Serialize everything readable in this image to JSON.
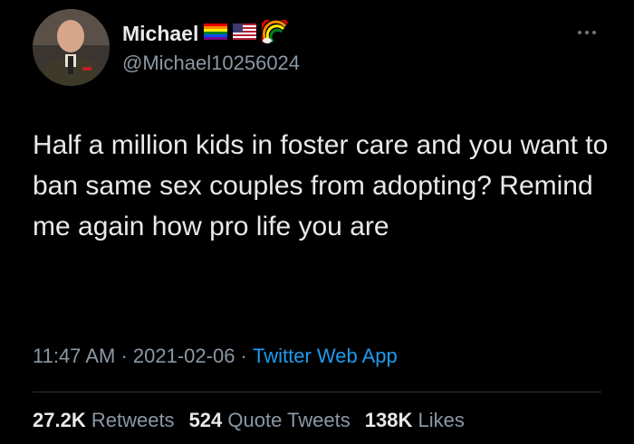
{
  "author": {
    "display_name": "Michael",
    "handle": "@Michael10256024",
    "name_emojis": [
      "rainbow-flag-icon",
      "us-flag-icon",
      "rainbow-icon"
    ]
  },
  "tweet": {
    "text": "Half a million kids in foster care and you want to ban same sex couples from adopting? Remind me again how pro life you are"
  },
  "meta": {
    "time": "11:47 AM",
    "sep1": " · ",
    "date": "2021-02-06",
    "sep2": " · ",
    "source": "Twitter Web App"
  },
  "stats": {
    "retweets_count": "27.2K",
    "retweets_label": "Retweets",
    "quotes_count": "524",
    "quotes_label": "Quote Tweets",
    "likes_count": "138K",
    "likes_label": "Likes"
  },
  "colors": {
    "background": "#000000",
    "primary_text": "#e7e9ea",
    "secondary_text": "#8b98a5",
    "link": "#1d9bf0"
  }
}
